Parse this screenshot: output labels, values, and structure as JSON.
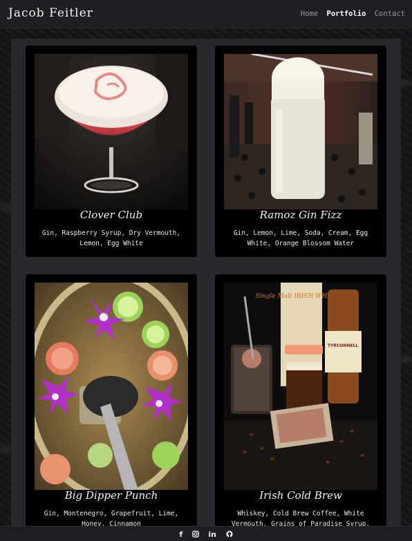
{
  "brand": "Jacob Feitler",
  "nav": {
    "home": "Home",
    "portfolio": "Portfolio",
    "contact": "Contact"
  },
  "cards": [
    {
      "title": "Clover Club",
      "desc": "Gin, Raspberry Syrup, Dry Vermouth, Lemon, Egg White"
    },
    {
      "title": "Ramoz Gin Fizz",
      "desc": "Gin, Lemon, Lime, Soda, Cream, Egg White, Orange Blossom Water"
    },
    {
      "title": "Big Dipper Punch",
      "desc": "Gin, Montenegro, Grapefruit, Lime, Honey, Cinnamon"
    },
    {
      "title": "Irish Cold Brew",
      "desc": "Whiskey, Cold Brew Coffee, White Vermouth, Grains of Paradise Syrup,"
    }
  ],
  "photo_labels": {
    "whiskey_brand": "TYRCONNELL",
    "whiskey_label": "Single Malt IRISH WHISKEY"
  },
  "footer_icons": [
    "facebook-icon",
    "instagram-icon",
    "linkedin-icon",
    "github-icon"
  ],
  "colors": {
    "background": "#0d0d0f",
    "navbar": "#1f1f23",
    "panel": "#29292d",
    "card": "#000000"
  }
}
